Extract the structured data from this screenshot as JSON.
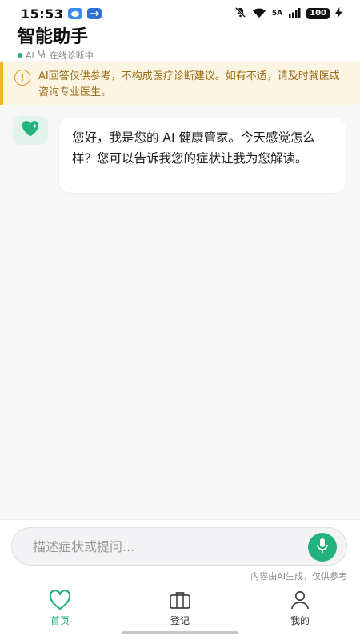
{
  "status_bar": {
    "time": "15:53",
    "network_label": "5A",
    "battery": "100",
    "icons": [
      "message-icon",
      "usb-icon",
      "mute-bell-icon",
      "wifi-icon",
      "signal-icon",
      "battery-icon",
      "charging-icon"
    ]
  },
  "header": {
    "title": "智能助手",
    "ai_label": "AI",
    "status_text": "在线诊断中"
  },
  "disclaimer": {
    "text": "AI回答仅供参考，不构成医疗诊断建议。如有不适，请及时就医或咨询专业医生。"
  },
  "chat": {
    "messages": [
      {
        "sender": "assistant",
        "text": "您好，我是您的 AI 健康管家。今天感觉怎么样？您可以告诉我您的症状让我为您解读。"
      }
    ]
  },
  "input": {
    "placeholder": "描述症状或提问...",
    "value": "",
    "note": "内容由AI生成，仅供参考"
  },
  "nav": {
    "items": [
      {
        "label": "首页",
        "icon": "heart-icon",
        "active": true
      },
      {
        "label": "登记",
        "icon": "briefcase-icon",
        "active": false
      },
      {
        "label": "我的",
        "icon": "user-icon",
        "active": false
      }
    ]
  },
  "colors": {
    "accent": "#23b27d",
    "warning_bg": "#fcf5e4",
    "warning_border": "#f0b429",
    "warning_text": "#9a6a12"
  }
}
